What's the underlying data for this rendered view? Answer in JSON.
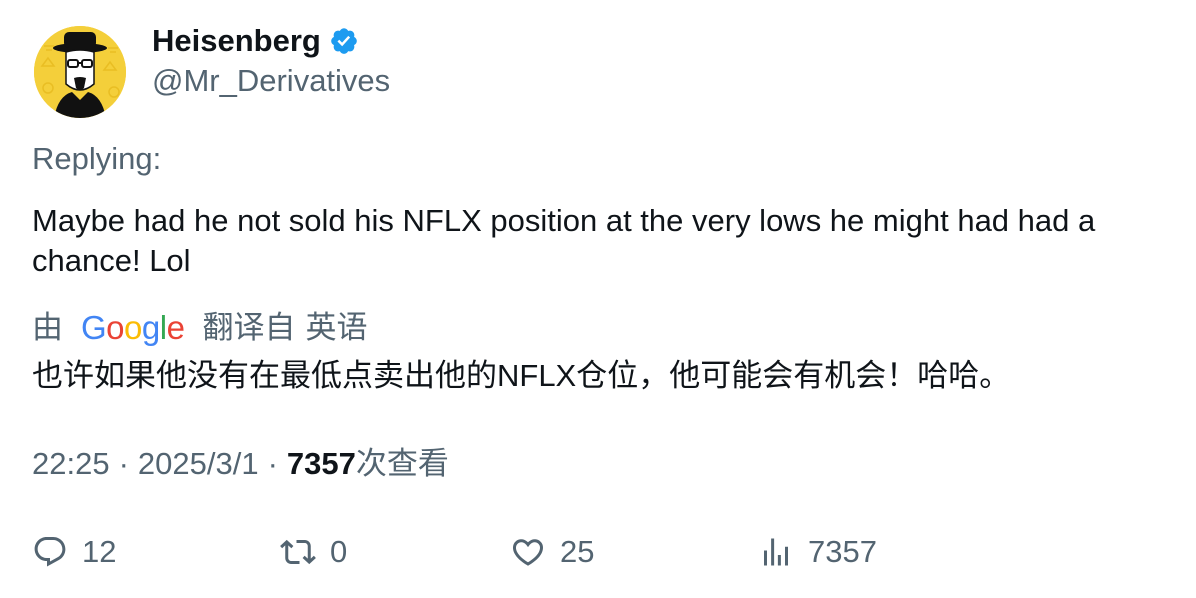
{
  "author": {
    "display_name": "Heisenberg",
    "handle": "@Mr_Derivatives",
    "verified": true,
    "avatar_icon": "heisenberg-avatar-icon"
  },
  "replying_label": "Replying:",
  "body": "Maybe had he not sold his NFLX position at the very lows he might had had a chance! Lol",
  "translation": {
    "by_label": "由",
    "provider_letters": [
      "G",
      "o",
      "o",
      "g",
      "l",
      "e"
    ],
    "translated_from_label": "翻译自",
    "language": "英语",
    "text": "也许如果他没有在最低点卖出他的NFLX仓位，他可能会有机会！哈哈。"
  },
  "meta": {
    "time": "22:25",
    "date": "2025/3/1",
    "separator": "·",
    "views_count": "7357",
    "views_label": "次查看"
  },
  "actions": {
    "replies": "12",
    "retweets": "0",
    "likes": "25",
    "views": "7357"
  },
  "colors": {
    "text_primary": "#0f1419",
    "text_secondary": "#536471",
    "verified_blue": "#1d9bf0",
    "avatar_bg": "#f4cf3a"
  }
}
